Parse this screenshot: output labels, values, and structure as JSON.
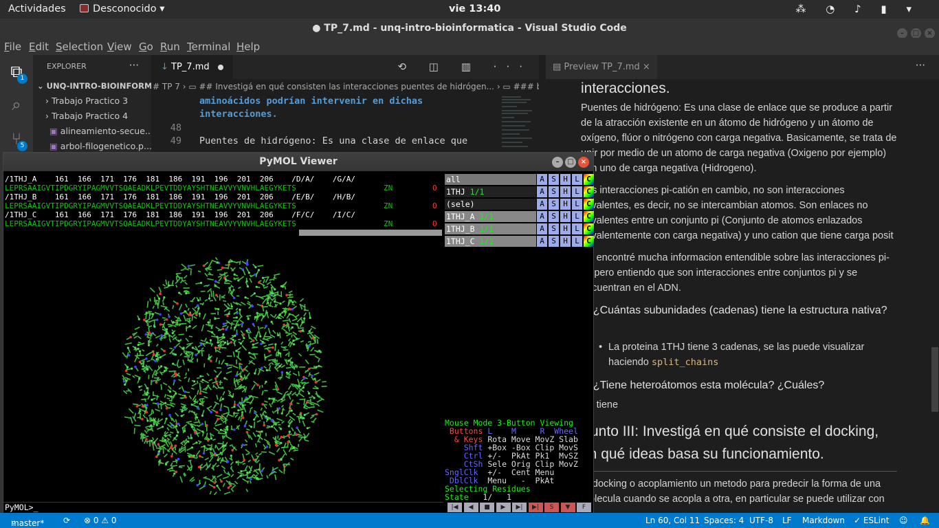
{
  "gnome": {
    "activities": "Actividades",
    "app": "Desconocido ▾",
    "clock": "vie 13:40",
    "tray": "⁂ ◔ ♪ ▮ ▾"
  },
  "window": {
    "title": "● TP_7.md - unq-intro-bioinformatica - Visual Studio Code"
  },
  "menu": [
    "File",
    "Edit",
    "Selection",
    "View",
    "Go",
    "Run",
    "Terminal",
    "Help"
  ],
  "activity": {
    "explorer_badge": "1",
    "scm_badge": "5"
  },
  "sidebar": {
    "title": "EXPLORER",
    "dots": "···",
    "folder": "UNQ-INTRO-BIOINFORMA...",
    "items": [
      "Trabajo Practico 3",
      "Trabajo Practico 4",
      "alineamiento-secue...",
      "arbol-filogenetico.p..."
    ]
  },
  "tabs": {
    "active": "TP_7.md",
    "toolbar": "⟲ ◫ ▥ ···"
  },
  "breadcrumb": "# TP 7 › ▭ ## Investigá en qué consisten las interacciones puentes de hidrógen... › ▭ ### b",
  "editor": {
    "lines": [
      {
        "num": "",
        "text": "aminoácidos podrían intervenir en dichas",
        "bold": true
      },
      {
        "num": "",
        "text": "interacciones.",
        "bold": true
      },
      {
        "num": "48",
        "text": "",
        "bold": false
      },
      {
        "num": "49",
        "text": "Puentes de hidrógeno:  Es una clase de enlace que",
        "bold": false
      }
    ]
  },
  "preview": {
    "tab": "Preview TP_7.md",
    "dots": "···",
    "blocks": [
      {
        "type": "h",
        "text": "interacciones."
      },
      {
        "type": "p",
        "text": "Puentes de hidrógeno: Es una clase de enlace que se produce a partir de la atracción existente en un átomo de hidrógeno y un átomo de oxígeno, flúor o nitrógeno con carga negativa. Basicamente, se trata de unir por medio de un atomo de carga negativa (Oxigeno por ejemplo) con uno de carga negativa (Hidrogeno)."
      },
      {
        "type": "p",
        "text": "Las interacciones pi-catión en cambio, no son interacciones covalentes, es decir, no se intercambian atomos. Son enlaces no covalentes entre un conjunto pi (Conjunto de atomos enlazados covalentemente con carga negativa) y uno cation que tiene carga posit"
      },
      {
        "type": "p",
        "text": "No encontré mucha informacion entendible sobre las interacciones pi-pi, pero entiendo que son interacciones entre conjuntos pi y se encuentran en el ADN."
      },
      {
        "type": "h4",
        "text": "a. ¿Cuántas subunidades (cadenas) tiene la estructura nativa?"
      },
      {
        "type": "li",
        "text": "La proteina 1THJ tiene 3 cadenas, se las puede visualizar haciendo",
        "code": "split_chains"
      },
      {
        "type": "h4",
        "text": "b. ¿Tiene heteroátomos esta molécula? ¿Cuáles?"
      },
      {
        "type": "p",
        "text": "No tiene"
      },
      {
        "type": "h",
        "text": "Punto III: Investigá en qué consiste el docking, en qué ideas basa su funcionamiento."
      },
      {
        "type": "p",
        "text": "El docking o acoplamiento un metodo para predecir la forma de una molecula cuando se acopla a otra, en particular se puede utilizar con"
      }
    ]
  },
  "status": {
    "branch": "master*",
    "sync": "⟳",
    "problems": "⊗ 0 ⚠ 0",
    "position": "Ln 60, Col 11",
    "spaces": "Spaces: 4",
    "encoding": "UTF-8",
    "eol": "LF",
    "language": "Markdown",
    "eslint": "✓ ESLint",
    "feedback": "☺",
    "bell": "🔔"
  },
  "pymol": {
    "title": "PyMOL Viewer",
    "prompt": "PyMOL>_",
    "sequence": [
      {
        "header": "/1THJ_A    161  166  171  176  181  186  191  196  201  206    /D/A/    /G/A/",
        "seq": "LEPRSAAIGVTIPDGRYIPAGMVVTSQAEADKLPEVTDDYAYSHTNEAVVYVNVHLAEGYKETS",
        "zn": "ZN",
        "o": "O"
      },
      {
        "header": "/1THJ_B    161  166  171  176  181  186  191  196  201  206    /E/B/    /H/B/",
        "seq": "LEPRSAAIGVTIPDGRYIPAGMVVTSQAEADKLPEVTDDYAYSHTNEAVVYVNVHLAEGYKETS",
        "zn": "ZN",
        "o": "O"
      },
      {
        "header": "/1THJ_C    161  166  171  176  181  186  191  196  201  206    /F/C/    /I/C/",
        "seq": "LEPRSAAIGVTIPDGRYIPAGMVVTSQAEADKLPEVTDDYAYSHTNEAVVYVNVHLAEGYKETS",
        "zn": "ZN",
        "o": "O"
      }
    ],
    "objects": [
      {
        "name": "all",
        "count": ""
      },
      {
        "name": "1THJ",
        "count": "1/1"
      },
      {
        "name": "(sele)",
        "count": ""
      },
      {
        "name": "1THJ_A",
        "count": "1/1"
      },
      {
        "name": "1THJ_B",
        "count": "1/1"
      },
      {
        "name": "1THJ_C",
        "count": "1/1"
      }
    ],
    "obj_buttons": [
      "A",
      "S",
      "H",
      "L",
      "C"
    ],
    "mouse": {
      "mode": "Mouse Mode 3-Button Viewing",
      "header": [
        " Buttons",
        " L",
        "    M",
        "     R",
        "  Wheel"
      ],
      "rows": [
        {
          "k": "  & Keys",
          "v": " Rota Move MovZ Slab"
        },
        {
          "k": "    Shft",
          "v": " +Box -Box Clip MovS"
        },
        {
          "k": "    Ctrl",
          "v": " +/-  PkAt Pk1  MvSZ"
        },
        {
          "k": "    CtSh",
          "v": " Sele Orig Clip MovZ"
        },
        {
          "k": "SnglClk",
          "v": "  +/-  Cent Menu"
        },
        {
          "k": " DblClk",
          "v": "  Menu   -  PkAt"
        }
      ],
      "selecting": "Selecting Residues",
      "state_label": "State",
      "state_value": "   1/   1"
    },
    "playbar": [
      "|◀",
      "◀",
      "■",
      "▶",
      "▶|",
      "▶|",
      "S",
      "▼",
      "F"
    ]
  }
}
